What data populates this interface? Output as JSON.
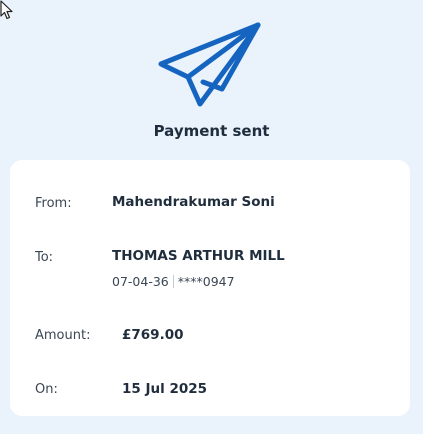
{
  "title": "Payment sent",
  "details": {
    "from_label": "From:",
    "from_value": "Mahendrakumar Soni",
    "to_label": "To:",
    "to_name": "THOMAS ARTHUR MILL",
    "to_sort_code": "07-04-36",
    "to_account": "****0947",
    "amount_label": "Amount:",
    "amount_value": "£769.00",
    "on_label": "On:",
    "on_value": "15 Jul 2025"
  },
  "icons": {
    "hero": "paper-plane-icon",
    "cursor": "mouse-pointer-icon"
  },
  "colors": {
    "background": "#eaf2fc",
    "card": "#ffffff",
    "accent": "#1565c0",
    "text": "#1f2d3d"
  }
}
